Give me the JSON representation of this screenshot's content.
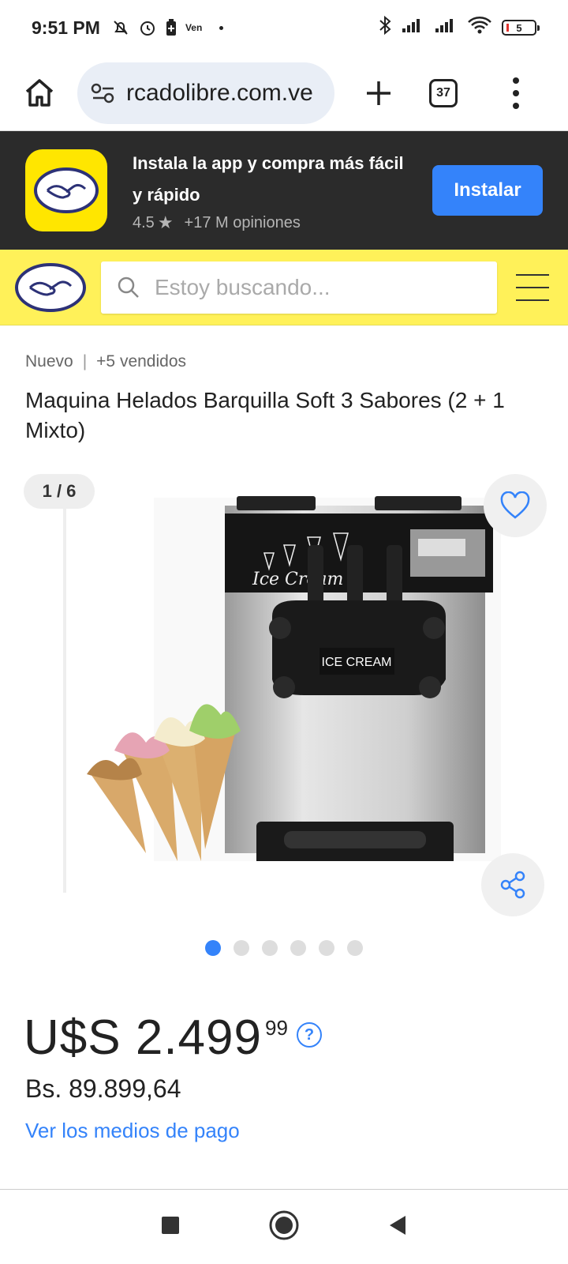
{
  "status_bar": {
    "time": "9:51 PM",
    "carrier_label": "Ven",
    "battery_level": "5"
  },
  "browser": {
    "url": "rcadolibre.com.ve",
    "tab_count": "37"
  },
  "app_banner": {
    "title": "Instala la app y compra más fácil y rápido",
    "rating": "4.5",
    "reviews": "+17 M opiniones",
    "install_label": "Instalar"
  },
  "header": {
    "search_placeholder": "Estoy buscando..."
  },
  "product": {
    "condition": "Nuevo",
    "sold": "+5 vendidos",
    "title": "Maquina Helados Barquilla Soft 3 Sabores (2 + 1 Mixto)",
    "image_counter": "1 / 6",
    "image_label": "ICE CREAM",
    "image_script": "Ice Cream",
    "price_main": "U$S 2.499",
    "price_cents": "99",
    "price_local": "Bs. 89.899,64",
    "payment_link": "Ver los medios de pago",
    "gallery_total": 6,
    "gallery_active": 1
  },
  "colors": {
    "brand_yellow": "#fff159",
    "accent_blue": "#3483fa",
    "banner_dark": "#2b2b2b"
  }
}
